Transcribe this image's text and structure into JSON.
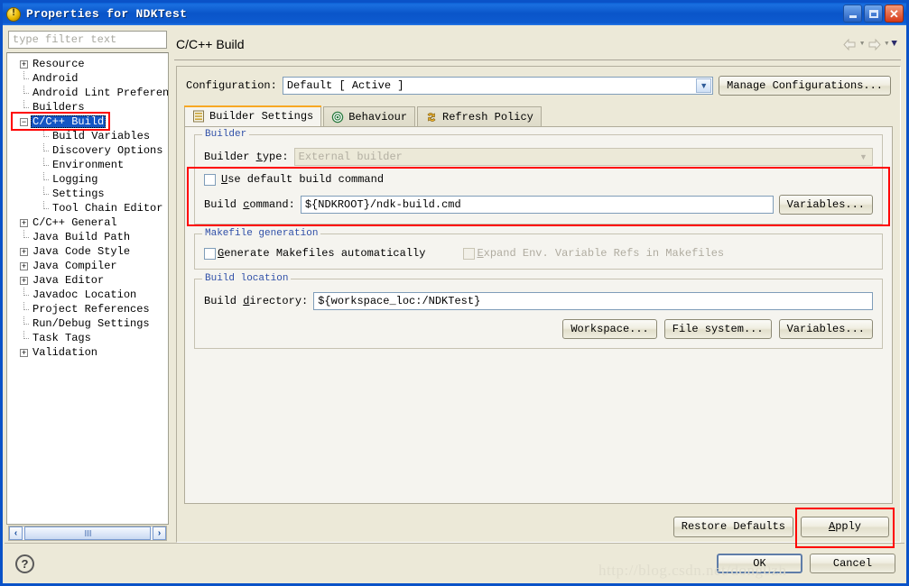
{
  "window": {
    "title": "Properties for NDKTest",
    "icon": "info-circle-icon",
    "buttons": {
      "minimize": "minimize-icon",
      "maximize": "maximize-icon",
      "close": "close-icon"
    }
  },
  "sidebar": {
    "filter_placeholder": "type filter text",
    "selected": "C/C++ Build",
    "items": [
      {
        "label": "Resource",
        "expandable": true,
        "expanded": false,
        "indent": 0
      },
      {
        "label": "Android",
        "expandable": false,
        "expanded": false,
        "indent": 0
      },
      {
        "label": "Android Lint Preferences",
        "expandable": false,
        "expanded": false,
        "indent": 0
      },
      {
        "label": "Builders",
        "expandable": false,
        "expanded": false,
        "indent": 0
      },
      {
        "label": "C/C++ Build",
        "expandable": true,
        "expanded": true,
        "indent": 0
      },
      {
        "label": "Build Variables",
        "expandable": false,
        "expanded": false,
        "indent": 1
      },
      {
        "label": "Discovery Options",
        "expandable": false,
        "expanded": false,
        "indent": 1
      },
      {
        "label": "Environment",
        "expandable": false,
        "expanded": false,
        "indent": 1
      },
      {
        "label": "Logging",
        "expandable": false,
        "expanded": false,
        "indent": 1
      },
      {
        "label": "Settings",
        "expandable": false,
        "expanded": false,
        "indent": 1
      },
      {
        "label": "Tool Chain Editor",
        "expandable": false,
        "expanded": false,
        "indent": 1
      },
      {
        "label": "C/C++ General",
        "expandable": true,
        "expanded": false,
        "indent": 0
      },
      {
        "label": "Java Build Path",
        "expandable": false,
        "expanded": false,
        "indent": 0
      },
      {
        "label": "Java Code Style",
        "expandable": true,
        "expanded": false,
        "indent": 0
      },
      {
        "label": "Java Compiler",
        "expandable": true,
        "expanded": false,
        "indent": 0
      },
      {
        "label": "Java Editor",
        "expandable": true,
        "expanded": false,
        "indent": 0
      },
      {
        "label": "Javadoc Location",
        "expandable": false,
        "expanded": false,
        "indent": 0
      },
      {
        "label": "Project References",
        "expandable": false,
        "expanded": false,
        "indent": 0
      },
      {
        "label": "Run/Debug Settings",
        "expandable": false,
        "expanded": false,
        "indent": 0
      },
      {
        "label": "Task Tags",
        "expandable": false,
        "expanded": false,
        "indent": 0
      },
      {
        "label": "Validation",
        "expandable": true,
        "expanded": false,
        "indent": 0
      }
    ],
    "scrollbar": {
      "left_arrow": "‹",
      "right_arrow": "›"
    }
  },
  "page": {
    "title": "C/C++ Build",
    "nav": {
      "back": "back-arrow-icon",
      "forward": "forward-arrow-icon",
      "menu": "view-menu-icon"
    },
    "configuration": {
      "label": "Configuration:",
      "value": "Default  [ Active ]",
      "manage_button": "Manage Configurations..."
    },
    "tabs": [
      {
        "label": "Builder Settings",
        "icon": "list-settings-icon",
        "active": true
      },
      {
        "label": "Behaviour",
        "icon": "target-circle-icon",
        "active": false
      },
      {
        "label": "Refresh Policy",
        "icon": "refresh-arrows-icon",
        "active": false
      }
    ],
    "builder_group": {
      "legend": "Builder",
      "builder_type_label": "Builder type:",
      "builder_type_value": "External builder",
      "use_default_label": "Use default build command",
      "use_default_checked": false,
      "build_command_label": "Build command:",
      "build_command_value": "${NDKROOT}/ndk-build.cmd",
      "variables_button": "Variables..."
    },
    "makefile_group": {
      "legend": "Makefile generation",
      "generate_label": "Generate Makefiles automatically",
      "generate_checked": false,
      "expand_label": "Expand Env. Variable Refs in Makefiles",
      "expand_checked": false,
      "expand_disabled": true
    },
    "build_location_group": {
      "legend": "Build location",
      "build_dir_label": "Build directory:",
      "build_dir_value": "${workspace_loc:/NDKTest}",
      "workspace_button": "Workspace...",
      "filesystem_button": "File system...",
      "variables_button": "Variables..."
    }
  },
  "footer": {
    "restore_defaults": "Restore Defaults",
    "apply": "Apply",
    "ok": "OK",
    "cancel": "Cancel",
    "help_icon": "help-question-icon"
  },
  "watermark": "http://blog.csdn.net/dong0zh",
  "colors": {
    "titlebar_blue": "#0a52c8",
    "selection_blue": "#1455c4",
    "annotation_red": "#ff0000",
    "panel_beige": "#ece9d8",
    "tab_active": "#f5f4ef",
    "tab_accent_orange": "#f7a823",
    "group_legend_blue": "#2f4fa8"
  }
}
